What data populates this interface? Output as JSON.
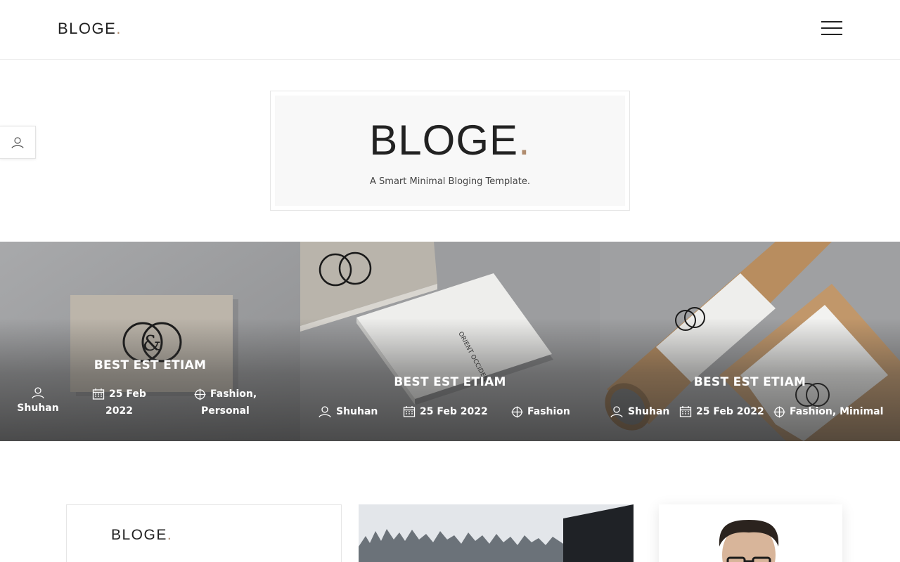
{
  "header": {
    "logo_text": "BLOGE",
    "logo_dot": ".",
    "menu_icon": "hamburger-menu-icon"
  },
  "side_tab": {
    "icon": "user-icon"
  },
  "hero": {
    "title": "BLOGE",
    "title_dot": ".",
    "tagline": "A Smart Minimal Bloging Template."
  },
  "slides": [
    {
      "title": "BEST EST ETIAM",
      "author": "Shuhan",
      "date_line1": "25 Feb",
      "date_line2": "2022",
      "category_line1": "Fashion,",
      "category_line2": "Personal"
    },
    {
      "title": "BEST EST ETIAM",
      "author": "Shuhan",
      "date": "25 Feb 2022",
      "category": "Fashion"
    },
    {
      "title": "BEST EST ETIAM",
      "author": "Shuhan",
      "date": "25 Feb 2022",
      "category": "Fashion, Minimal"
    }
  ],
  "cards": {
    "card1_logo": "BLOGE",
    "card1_logo_dot": "."
  },
  "colors": {
    "accent_dot": "#b08c6e",
    "text": "#222222",
    "hero_bg": "#f8f8f8"
  }
}
